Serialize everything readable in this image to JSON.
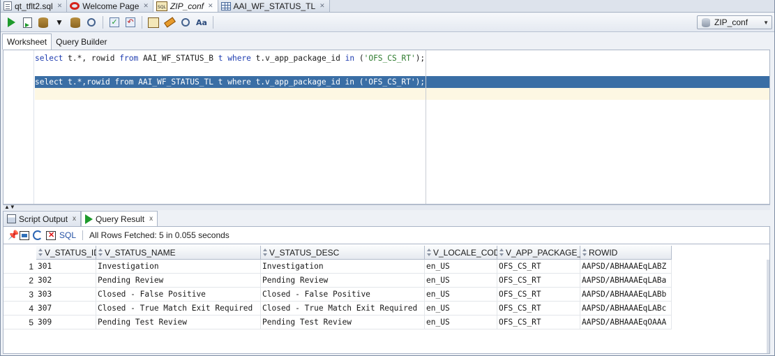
{
  "doc_tabs": [
    {
      "label": "qt_tflt2.sql",
      "icon": "sql-file-icon",
      "close": "✕",
      "active": false
    },
    {
      "label": "Welcome Page",
      "icon": "oracle-icon",
      "close": "✕",
      "active": false
    },
    {
      "label": "ZIP_conf",
      "icon": "sql-worksheet-icon",
      "close": "✕",
      "active": true
    },
    {
      "label": "AAI_WF_STATUS_TL",
      "icon": "table-icon",
      "close": "✕",
      "active": false
    }
  ],
  "toolbar": {
    "connection": "ZIP_conf",
    "buttons": [
      "run-statement-icon",
      "run-script-icon",
      "autotrace-icon",
      "explain-plan-icon",
      "sql-tuning-icon",
      "commit-icon",
      "rollback-icon",
      "unshared-sql-icon",
      "clear-icon",
      "history-icon",
      "format-icon"
    ]
  },
  "worksheet_tabs": [
    "Worksheet",
    "Query Builder"
  ],
  "editor": {
    "line1": {
      "kw1": "select",
      "t1": " t.*, rowid ",
      "kw2": "from",
      "t2": " AAI_WF_STATUS_B ",
      "kw3": "t",
      "t3": " ",
      "kw4": "where",
      "t4": " t.v_app_package_id ",
      "kw5": "in",
      "t5": " (",
      "str": "'OFS_CS_RT'",
      "t6": ");"
    },
    "line3": "select t.*,rowid from AAI_WF_STATUS_TL t where t.v_app_package_id in ('OFS_CS_RT');"
  },
  "result_tabs": [
    {
      "label": "Script Output",
      "close": "x"
    },
    {
      "label": "Query Result",
      "close": "x"
    }
  ],
  "result_toolbar": {
    "sql_label": "SQL",
    "status": "All Rows Fetched: 5 in 0.055 seconds"
  },
  "grid": {
    "columns": [
      "V_STATUS_ID",
      "V_STATUS_NAME",
      "V_STATUS_DESC",
      "V_LOCALE_CODE",
      "V_APP_PACKAGE_ID",
      "ROWID"
    ],
    "rows": [
      {
        "n": "1",
        "cells": [
          "301",
          "Investigation",
          "Investigation",
          "en_US",
          "OFS_CS_RT",
          "AAPSD/ABHAAAEqLABZ"
        ]
      },
      {
        "n": "2",
        "cells": [
          "302",
          "Pending Review",
          "Pending Review",
          "en_US",
          "OFS_CS_RT",
          "AAPSD/ABHAAAEqLABa"
        ]
      },
      {
        "n": "3",
        "cells": [
          "303",
          "Closed - False Positive",
          "Closed - False Positive",
          "en_US",
          "OFS_CS_RT",
          "AAPSD/ABHAAAEqLABb"
        ]
      },
      {
        "n": "4",
        "cells": [
          "307",
          "Closed - True Match Exit Required",
          "Closed - True Match Exit Required",
          "en_US",
          "OFS_CS_RT",
          "AAPSD/ABHAAAEqLABc"
        ]
      },
      {
        "n": "5",
        "cells": [
          "309",
          "Pending Test Review",
          "Pending Test Review",
          "en_US",
          "OFS_CS_RT",
          "AAPSD/ABHAAAEqOAAA"
        ]
      }
    ]
  }
}
